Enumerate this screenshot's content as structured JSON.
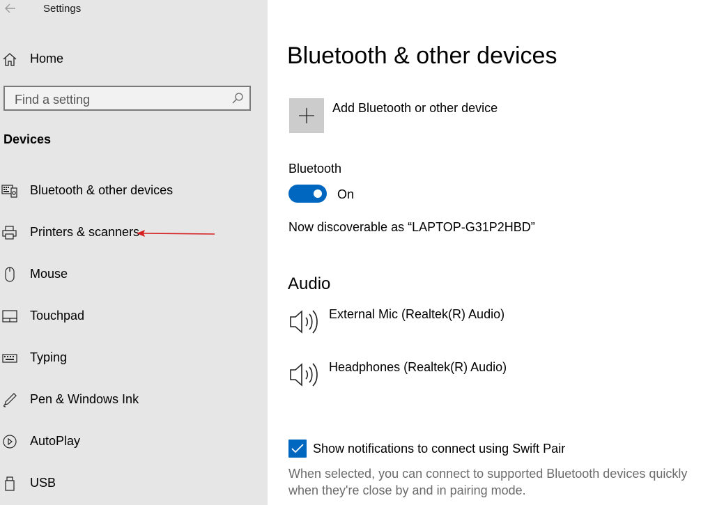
{
  "window": {
    "title": "Settings"
  },
  "sidebar": {
    "home_label": "Home",
    "search_placeholder": "Find a setting",
    "section": "Devices",
    "items": [
      {
        "label": "Bluetooth & other devices",
        "icon": "bluetooth-devices-icon"
      },
      {
        "label": "Printers & scanners",
        "icon": "printer-icon"
      },
      {
        "label": "Mouse",
        "icon": "mouse-icon"
      },
      {
        "label": "Touchpad",
        "icon": "touchpad-icon"
      },
      {
        "label": "Typing",
        "icon": "keyboard-icon"
      },
      {
        "label": "Pen & Windows Ink",
        "icon": "pen-icon"
      },
      {
        "label": "AutoPlay",
        "icon": "autoplay-icon"
      },
      {
        "label": "USB",
        "icon": "usb-icon"
      }
    ]
  },
  "main": {
    "title": "Bluetooth & other devices",
    "add_device_label": "Add Bluetooth or other device",
    "bluetooth": {
      "label": "Bluetooth",
      "state": "On",
      "on": true,
      "discoverable_text": "Now discoverable as “LAPTOP-G31P2HBD”"
    },
    "audio": {
      "heading": "Audio",
      "devices": [
        "External Mic (Realtek(R) Audio)",
        "Headphones (Realtek(R) Audio)"
      ]
    },
    "swift_pair": {
      "checked": true,
      "label": "Show notifications to connect using Swift Pair",
      "description": "When selected, you can connect to supported Bluetooth devices quickly when they're close by and in pairing mode."
    }
  },
  "colors": {
    "accent": "#0067c0",
    "sidebar_bg": "#e6e6e6",
    "annotation_arrow": "#d42020"
  }
}
